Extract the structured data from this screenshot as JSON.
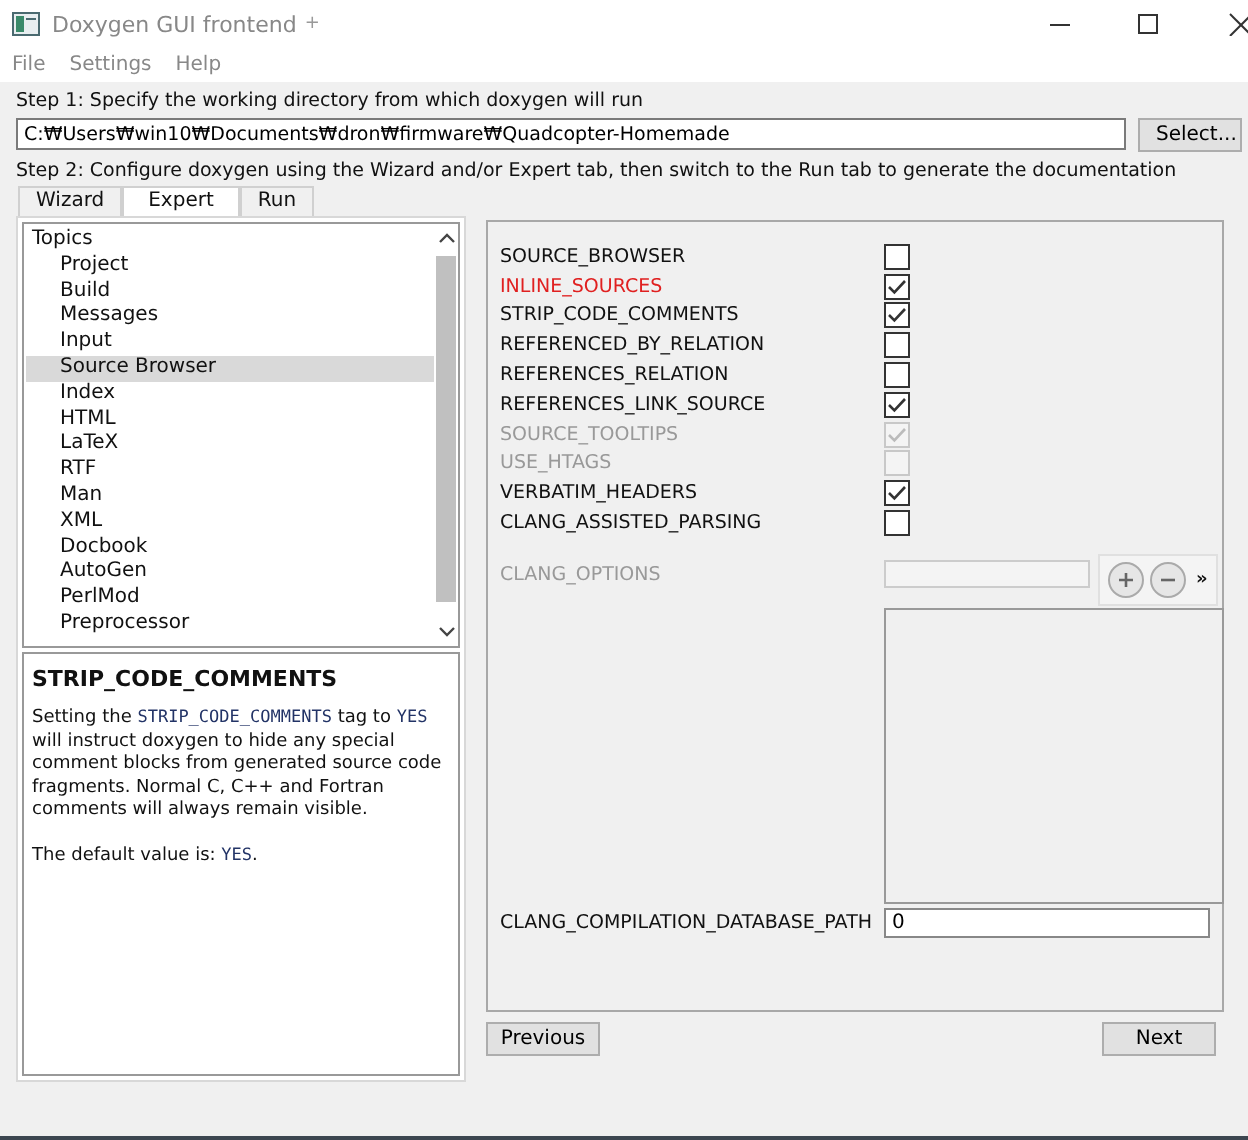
{
  "window": {
    "title": "Doxygen GUI frontend",
    "modified_marker": "+"
  },
  "menu": [
    "File",
    "Settings",
    "Help"
  ],
  "step1": {
    "label": "Step 1: Specify the working directory from which doxygen will run",
    "path": "C:₩Users₩win10₩Documents₩dron₩firmware₩Quadcopter-Homemade",
    "button": "Select..."
  },
  "step2": {
    "label": "Step 2: Configure doxygen using the Wizard and/or Expert tab, then switch to the Run tab to generate the documentation"
  },
  "tabs": [
    {
      "label": "Wizard",
      "selected": false
    },
    {
      "label": "Expert",
      "selected": true
    },
    {
      "label": "Run",
      "selected": false
    }
  ],
  "topics": {
    "label": "Topics",
    "children": [
      {
        "label": "Project",
        "selected": false
      },
      {
        "label": "Build",
        "selected": false
      },
      {
        "label": "Messages",
        "selected": false
      },
      {
        "label": "Input",
        "selected": false
      },
      {
        "label": "Source Browser",
        "selected": true
      },
      {
        "label": "Index",
        "selected": false
      },
      {
        "label": "HTML",
        "selected": false
      },
      {
        "label": "LaTeX",
        "selected": false
      },
      {
        "label": "RTF",
        "selected": false
      },
      {
        "label": "Man",
        "selected": false
      },
      {
        "label": "XML",
        "selected": false
      },
      {
        "label": "Docbook",
        "selected": false
      },
      {
        "label": "AutoGen",
        "selected": false
      },
      {
        "label": "PerlMod",
        "selected": false
      },
      {
        "label": "Preprocessor",
        "selected": false
      }
    ]
  },
  "description": {
    "title": "STRIP_CODE_COMMENTS",
    "paragraphs": [
      [
        {
          "kind": "text",
          "text": "Setting the "
        },
        {
          "kind": "code",
          "text": "STRIP_CODE_COMMENTS"
        },
        {
          "kind": "text",
          "text": " tag to "
        },
        {
          "kind": "code",
          "text": "YES"
        },
        {
          "kind": "text",
          "text": " will instruct doxygen to hide any special comment blocks from generated source code fragments. Normal C, C++ and Fortran comments will always remain visible."
        }
      ],
      [
        {
          "kind": "text",
          "text": "The default value is: "
        },
        {
          "kind": "code",
          "text": "YES"
        },
        {
          "kind": "text",
          "text": "."
        }
      ]
    ]
  },
  "settings": [
    {
      "kind": "checkbox",
      "label": "SOURCE_BROWSER",
      "checked": false,
      "disabled": false,
      "changed": false
    },
    {
      "kind": "checkbox",
      "label": "INLINE_SOURCES",
      "checked": true,
      "disabled": false,
      "changed": true
    },
    {
      "kind": "checkbox",
      "label": "STRIP_CODE_COMMENTS",
      "checked": true,
      "disabled": false,
      "changed": false
    },
    {
      "kind": "checkbox",
      "label": "REFERENCED_BY_RELATION",
      "checked": false,
      "disabled": false,
      "changed": false
    },
    {
      "kind": "checkbox",
      "label": "REFERENCES_RELATION",
      "checked": false,
      "disabled": false,
      "changed": false
    },
    {
      "kind": "checkbox",
      "label": "REFERENCES_LINK_SOURCE",
      "checked": true,
      "disabled": false,
      "changed": false
    },
    {
      "kind": "checkbox",
      "label": "SOURCE_TOOLTIPS",
      "checked": true,
      "disabled": true,
      "changed": false
    },
    {
      "kind": "checkbox",
      "label": "USE_HTAGS",
      "checked": false,
      "disabled": true,
      "changed": false
    },
    {
      "kind": "checkbox",
      "label": "VERBATIM_HEADERS",
      "checked": true,
      "disabled": false,
      "changed": false
    },
    {
      "kind": "checkbox",
      "label": "CLANG_ASSISTED_PARSING",
      "checked": false,
      "disabled": false,
      "changed": false
    },
    {
      "kind": "list",
      "label": "CLANG_OPTIONS",
      "disabled": true,
      "changed": false,
      "more": "»"
    },
    {
      "kind": "text",
      "label": "CLANG_COMPILATION_DATABASE_PATH",
      "value": "0",
      "disabled": false,
      "changed": false
    }
  ],
  "buttons": {
    "previous": "Previous",
    "next": "Next"
  }
}
